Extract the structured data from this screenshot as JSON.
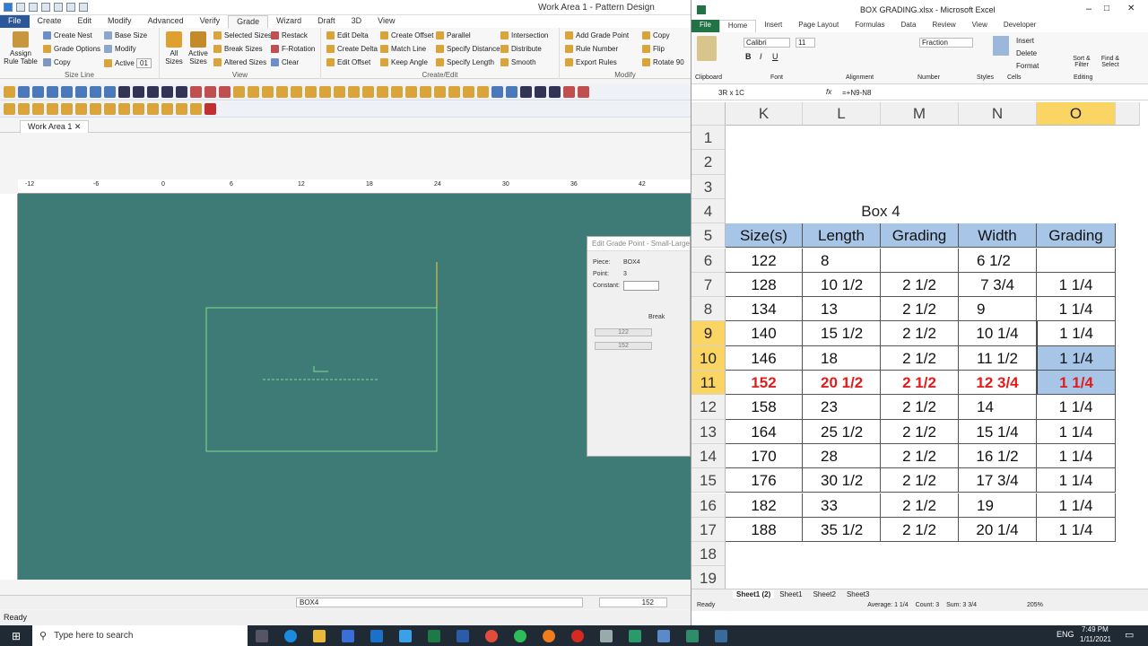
{
  "pattern_app": {
    "title": "Work Area 1 - Pattern Design",
    "tabs": [
      "File",
      "Create",
      "Edit",
      "Modify",
      "Advanced",
      "Verify",
      "Grade",
      "Wizard",
      "Draft",
      "3D",
      "View"
    ],
    "active_tab": "Grade",
    "ribbon": {
      "assign_rule_table": "Assign Rule Table",
      "create_nest": "Create Nest",
      "grade_options": "Grade Options",
      "copy": "Copy",
      "base_size": "Base Size",
      "modify": "Modify",
      "active": "Active",
      "active_value": "01",
      "all_sizes": "All Sizes",
      "active_sizes": "Active Sizes",
      "selected_sizes": "Selected Sizes",
      "break_sizes": "Break Sizes",
      "altered_sizes": "Altered Sizes",
      "restack": "Restack",
      "f_rotation": "F-Rotation",
      "clear": "Clear",
      "edit_delta": "Edit Delta",
      "create_delta": "Create Delta",
      "edit_offset": "Edit Offset",
      "create_offset": "Create Offset",
      "match_line": "Match Line",
      "keep_angle": "Keep Angle",
      "parallel": "Parallel",
      "specify_distance": "Specify Distance",
      "specify_length": "Specify Length",
      "intersection": "Intersection",
      "distribute": "Distribute",
      "smooth": "Smooth",
      "add_grade_point": "Add Grade Point",
      "rule_number": "Rule Number",
      "export_rules": "Export Rules",
      "copy2": "Copy",
      "flip": "Flip",
      "rotate_90": "Rotate 90",
      "groups": [
        "Size Line",
        "View",
        "Create/Edit",
        "Modify"
      ]
    },
    "doc_tab": "Work Area 1",
    "ruler_labels": [
      "-12",
      "-6",
      "0",
      "6",
      "12",
      "18",
      "24",
      "30",
      "36",
      "42"
    ],
    "dialog": {
      "title": "Edit Grade Point - Small-Large",
      "piece_label": "Piece:",
      "piece_value": "BOX4",
      "point_label": "Point:",
      "point_value": "3",
      "constant_label": "Constant:",
      "break_label": "Break",
      "size_a": "122",
      "size_b": "152"
    },
    "status_piece": "BOX4",
    "status_size": "152",
    "status_ready": "Ready"
  },
  "excel": {
    "title": "BOX GRADING.xlsx - Microsoft Excel",
    "tabs": [
      "File",
      "Home",
      "Insert",
      "Page Layout",
      "Formulas",
      "Data",
      "Review",
      "View",
      "Developer"
    ],
    "active_tab": "Home",
    "font_name": "Calibri",
    "font_size": "11",
    "number_format": "Fraction",
    "ribbon_groups": [
      "Clipboard",
      "Font",
      "Alignment",
      "Number",
      "Styles",
      "Cells",
      "Editing"
    ],
    "cells_buttons": [
      "Insert",
      "Delete",
      "Format"
    ],
    "editing_buttons": [
      "Sort & Filter",
      "Find & Select"
    ],
    "name_box": "3R x 1C",
    "formula": "=+N9-N8",
    "columns": [
      "K",
      "L",
      "M",
      "N",
      "O"
    ],
    "rows": [
      "1",
      "2",
      "3",
      "4",
      "5",
      "6",
      "7",
      "8",
      "9",
      "10",
      "11",
      "12",
      "13",
      "14",
      "15",
      "16",
      "17",
      "18",
      "19"
    ],
    "table_title": "Box 4",
    "headers": [
      "Size(s)",
      "Length",
      "Grading",
      "Width",
      "Grading"
    ],
    "data": [
      [
        "122",
        "8",
        "",
        "6 1/2",
        ""
      ],
      [
        "128",
        "10 1/2",
        "2 1/2",
        "7 3/4",
        "1 1/4"
      ],
      [
        "134",
        "13",
        "2 1/2",
        "9",
        "1 1/4"
      ],
      [
        "140",
        "15 1/2",
        "2 1/2",
        "10 1/4",
        "1 1/4"
      ],
      [
        "146",
        "18",
        "2 1/2",
        "11 1/2",
        "1 1/4"
      ],
      [
        "152",
        "20 1/2",
        "2 1/2",
        "12 3/4",
        "1 1/4"
      ],
      [
        "158",
        "23",
        "2 1/2",
        "14",
        "1 1/4"
      ],
      [
        "164",
        "25 1/2",
        "2 1/2",
        "15 1/4",
        "1 1/4"
      ],
      [
        "170",
        "28",
        "2 1/2",
        "16 1/2",
        "1 1/4"
      ],
      [
        "176",
        "30 1/2",
        "2 1/2",
        "17 3/4",
        "1 1/4"
      ],
      [
        "182",
        "33",
        "2 1/2",
        "19",
        "1 1/4"
      ],
      [
        "188",
        "35 1/2",
        "2 1/2",
        "20 1/4",
        "1 1/4"
      ]
    ],
    "highlight_row": "152",
    "sheets": [
      "Sheet1 (2)",
      "Sheet1",
      "Sheet2",
      "Sheet3"
    ],
    "status_ready": "Ready",
    "status_average": "Average: 1 1/4",
    "status_count": "Count: 3",
    "status_sum": "Sum: 3 3/4",
    "zoom": "205%"
  },
  "taskbar": {
    "search_placeholder": "Type here to search",
    "lang": "ENG",
    "time": "7:49 PM",
    "date": "1/11/2021"
  },
  "colors": {
    "canvas": "#3e7a76",
    "excel_header": "#a7c6e7",
    "selected_header": "#fad564",
    "red_row": "#e21c1c"
  }
}
